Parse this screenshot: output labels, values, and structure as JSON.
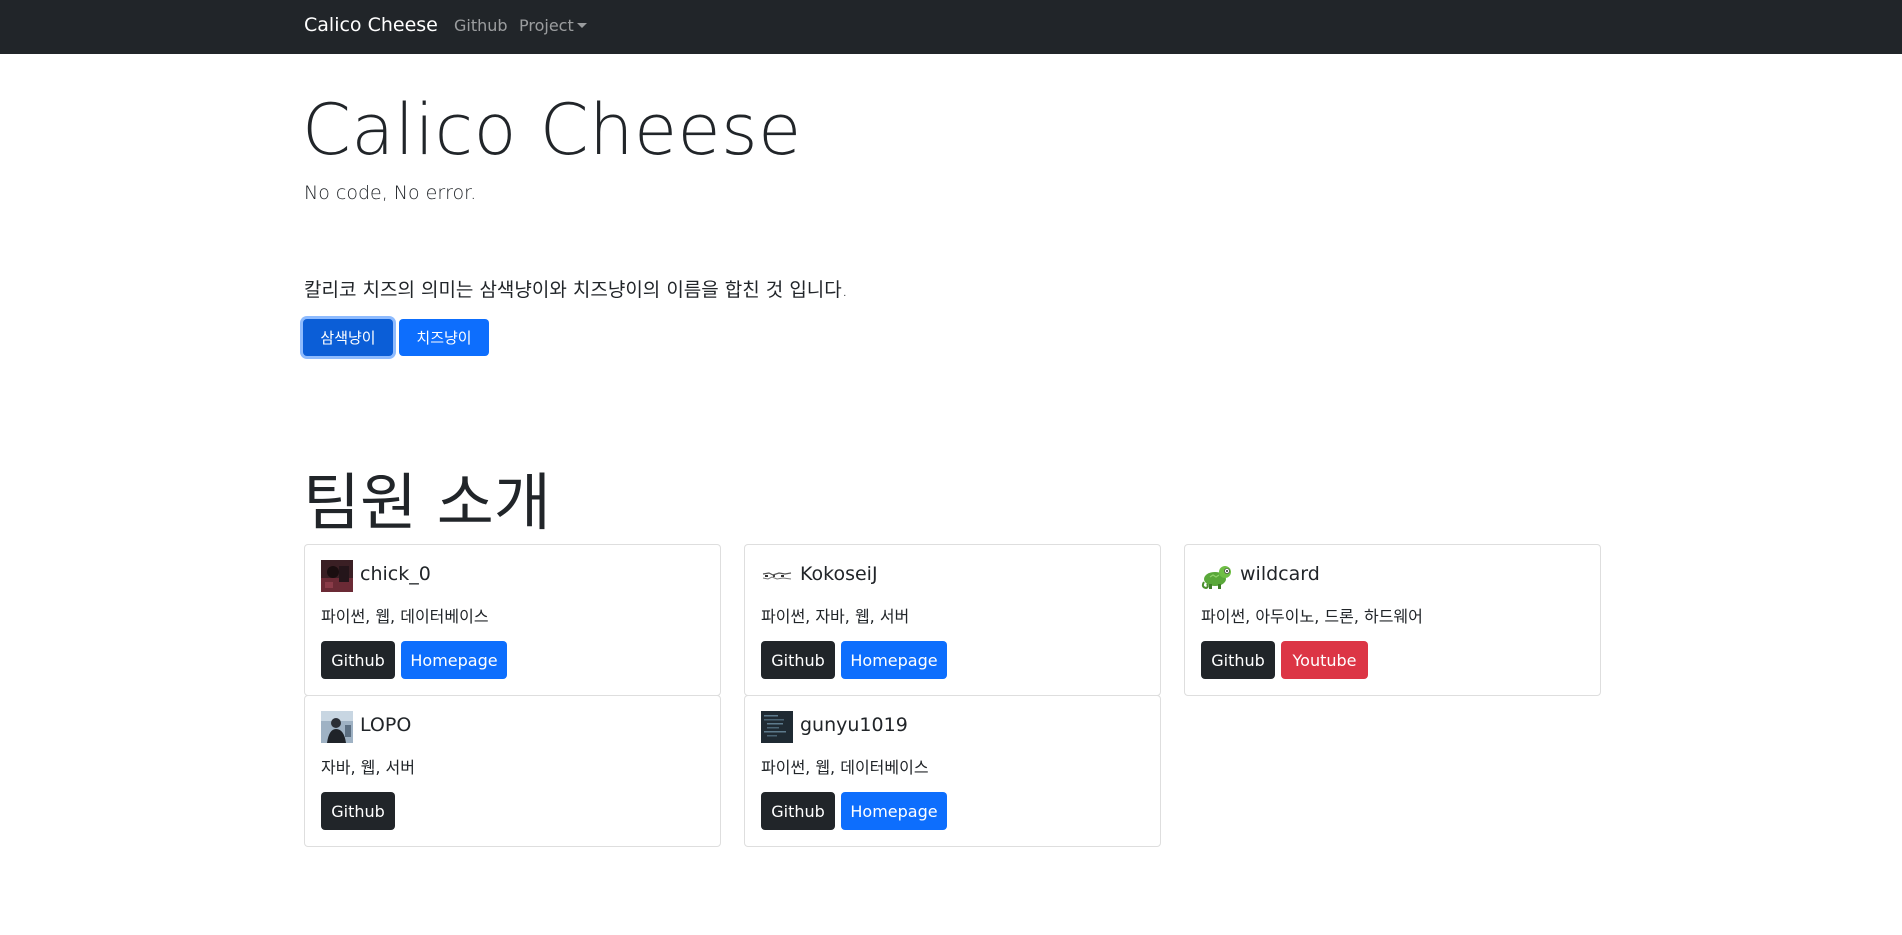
{
  "navbar": {
    "brand": "Calico Cheese",
    "links": {
      "github": "Github",
      "project": "Project"
    }
  },
  "hero": {
    "title": "Calico Cheese",
    "lead": "No code, No error.",
    "meaning": "칼리코 치즈의 의미는 삼색냥이와 치즈냥이의 이름을 합친 것 입니다.",
    "buttons": {
      "calico": "삼색냥이",
      "cheese": "치즈냥이"
    }
  },
  "team": {
    "title": "팀원 소개",
    "members": [
      {
        "name": "chick_0",
        "skills": "파이썬, 웹, 데이터베이스",
        "btn1": "Github",
        "btn2": "Homepage",
        "avatar": "dark-photo-avatar"
      },
      {
        "name": "KokoseiJ",
        "skills": "파이썬, 자바, 웹, 서버",
        "btn1": "Github",
        "btn2": "Homepage",
        "avatar": "sketch-avatar"
      },
      {
        "name": "wildcard",
        "skills": "파이썬, 아두이노, 드론, 하드웨어",
        "btn1": "Github",
        "btn2": "Youtube",
        "avatar": "chameleon-avatar"
      },
      {
        "name": "LOPO",
        "skills": "자바, 웹, 서버",
        "btn1": "Github",
        "avatar": "photo-avatar"
      },
      {
        "name": "gunyu1019",
        "skills": "파이썬, 웹, 데이터베이스",
        "btn1": "Github",
        "btn2": "Homepage",
        "avatar": "code-avatar"
      }
    ]
  },
  "colors": {
    "navbar_bg": "#212529",
    "primary": "#0d6efd",
    "primary_active": "#0b5ed7",
    "dark": "#212529",
    "danger": "#dc3545"
  }
}
